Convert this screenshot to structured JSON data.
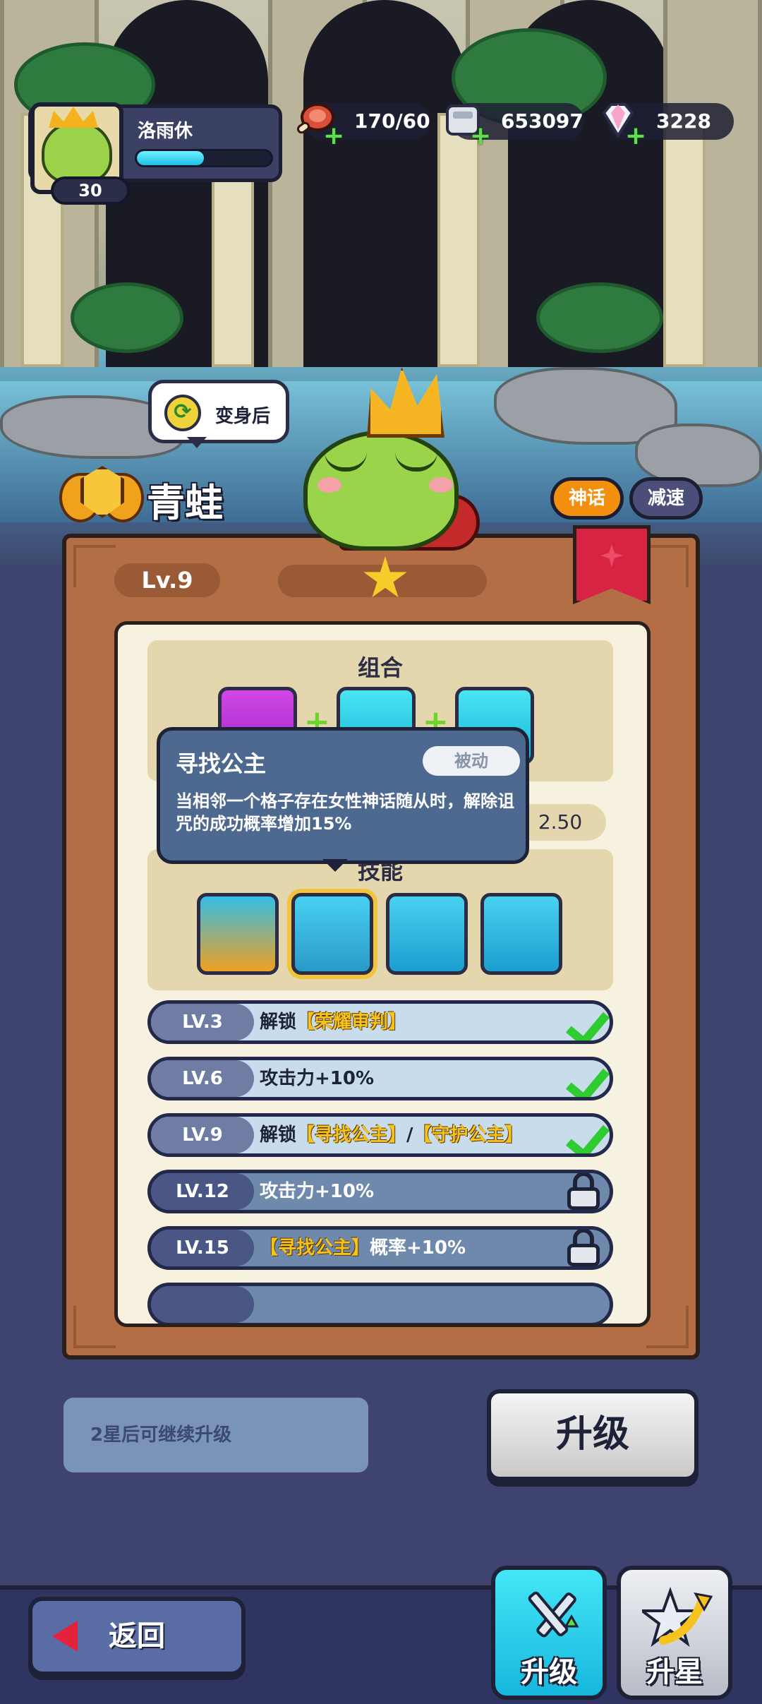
{
  "player": {
    "name": "洛雨休",
    "level": "30",
    "xp_fraction": 0.5
  },
  "resources": [
    {
      "icon": "meat-icon",
      "value": "170/60"
    },
    {
      "icon": "silver-coin-icon",
      "value": "653097"
    },
    {
      "icon": "diamond-icon",
      "value": "3228"
    }
  ],
  "transform": {
    "label": "变身后",
    "icon": "cycle-arrows-icon"
  },
  "hero": {
    "name": "青蛙",
    "tags": [
      "神话",
      "减速"
    ]
  },
  "panel": {
    "level_label": "Lv.9",
    "stars": 1,
    "combo_title": "组合",
    "combo_plus": "+",
    "stat_value": "2.50",
    "skills_title": "技能"
  },
  "tooltip": {
    "title": "寻找公主",
    "badge": "被动",
    "text": "当相邻一个格子存在女性神话随从时，解除诅咒的成功概率增加15%"
  },
  "unlocks": [
    {
      "level": "LV.3",
      "parts": [
        "解锁",
        "【荣耀审判】"
      ],
      "done": true
    },
    {
      "level": "LV.6",
      "parts": [
        "攻击力+10%"
      ],
      "done": true
    },
    {
      "level": "LV.9",
      "parts": [
        "解锁",
        "【寻找公主】",
        "/",
        "【守护公主】"
      ],
      "done": true
    },
    {
      "level": "LV.12",
      "parts": [
        "攻击力+10%"
      ],
      "done": false
    },
    {
      "level": "LV.15",
      "parts": [
        "【寻找公主】",
        "概率+10%"
      ],
      "done": false
    }
  ],
  "bottom": {
    "hint": "2星后可继续升级",
    "upgrade_button": "升级",
    "back_button": "返回",
    "nav_upgrade": "升级",
    "nav_star": "升星"
  },
  "colors": {
    "accent_cyan": "#1cc0e6",
    "myth_orange": "#f2900e",
    "check_green": "#2ecc30",
    "highlight_gold": "#f6c21c"
  }
}
